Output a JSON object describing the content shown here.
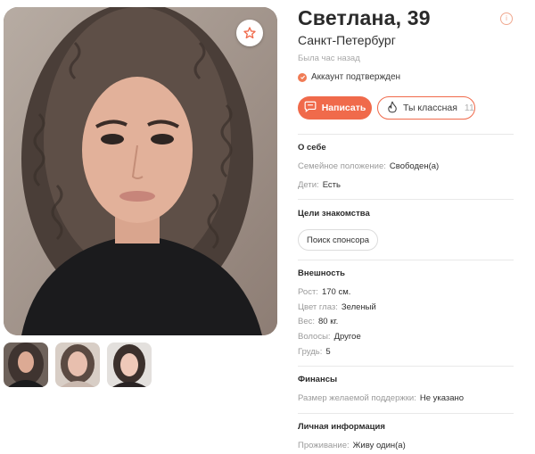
{
  "profile": {
    "name_age": "Светлана, 39",
    "city": "Санкт-Петербург",
    "last_seen": "Была час назад",
    "verified": "Аккаунт подтвержден"
  },
  "actions": {
    "write_label": "Написать",
    "like_label": "Ты классная",
    "like_count": "11"
  },
  "about": {
    "title": "О себе",
    "rows": [
      {
        "label": "Семейное положение:",
        "value": "Свободен(а)"
      },
      {
        "label": "Дети:",
        "value": "Есть"
      }
    ]
  },
  "goals": {
    "title": "Цели знакомства",
    "chips": [
      "Поиск спонсора"
    ]
  },
  "appearance": {
    "title": "Внешность",
    "rows": [
      {
        "label": "Рост:",
        "value": "170 см."
      },
      {
        "label": "Цвет глаз:",
        "value": "Зеленый"
      },
      {
        "label": "Вес:",
        "value": "80 кг."
      },
      {
        "label": "Волосы:",
        "value": "Другое"
      },
      {
        "label": "Грудь:",
        "value": "5"
      }
    ]
  },
  "finance": {
    "title": "Финансы",
    "rows": [
      {
        "label": "Размер желаемой поддержки:",
        "value": "Не указано"
      }
    ]
  },
  "personal": {
    "title": "Личная информация",
    "rows": [
      {
        "label": "Проживание:",
        "value": "Живу один(а)"
      }
    ]
  },
  "icons": {
    "favorite": "star-icon",
    "info": "info-icon",
    "verified": "check-icon",
    "write": "chat-bubble-icon",
    "like": "flame-icon"
  },
  "colors": {
    "accent": "#f06a4b",
    "muted_text": "#9a9a9a",
    "divider": "#e8e8e8"
  }
}
